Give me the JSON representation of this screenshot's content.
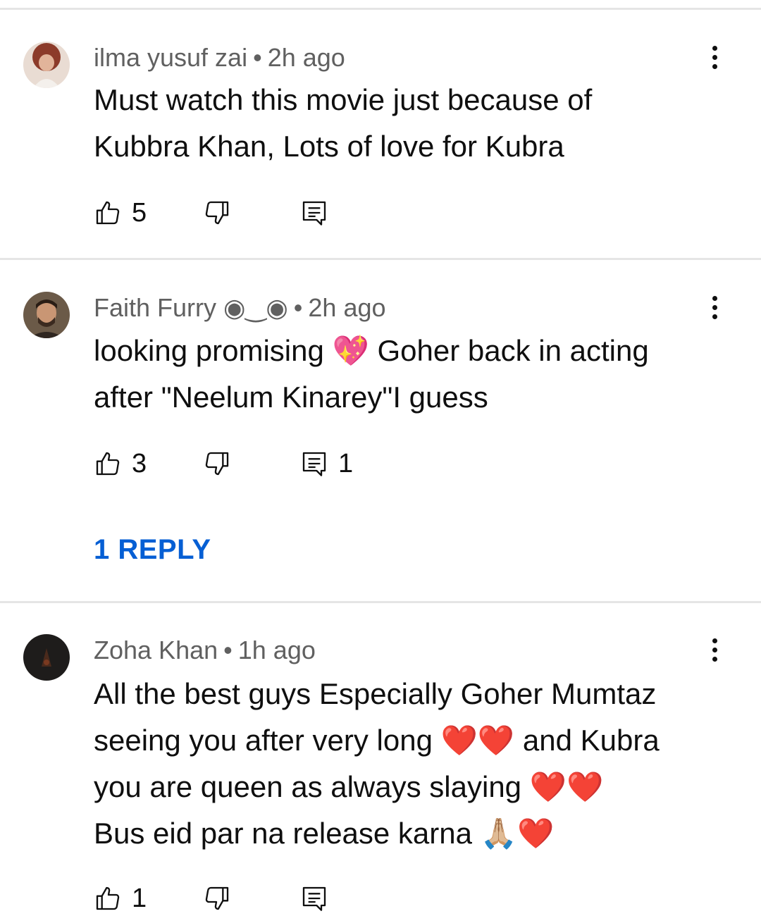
{
  "comments": [
    {
      "author": "ilma yusuf zai",
      "time": "2h ago",
      "lines": [
        "Must watch this movie just because of",
        "Kubbra Khan, Lots of love for Kubra"
      ],
      "likes": "5",
      "replies": ""
    },
    {
      "author": "Faith Furry ◉‿◉",
      "time": "2h ago",
      "line1_before": "looking promising ",
      "line1_emoji": "💖",
      "line1_after": " Goher back in acting",
      "line2": "after \"Neelum Kinarey\"I guess",
      "likes": "3",
      "replies": "1",
      "reply_link": "1 REPLY"
    },
    {
      "author": "Zoha Khan",
      "time": "1h ago",
      "line1": "All the best guys Especially Goher Mumtaz",
      "line2_before": "seeing you after very long ",
      "line2_emoji": "❤️❤️",
      "line2_after": " and Kubra",
      "line3_before": "you are queen as always slaying ",
      "line3_emoji": "❤️❤️",
      "line4_before": "Bus eid par na release karna ",
      "line4_emoji": "🙏🏼❤️",
      "likes": "1"
    }
  ],
  "separator": "•",
  "colors": {
    "accent": "#065fd4",
    "meta": "#606060",
    "divider": "#e5e5e5"
  }
}
